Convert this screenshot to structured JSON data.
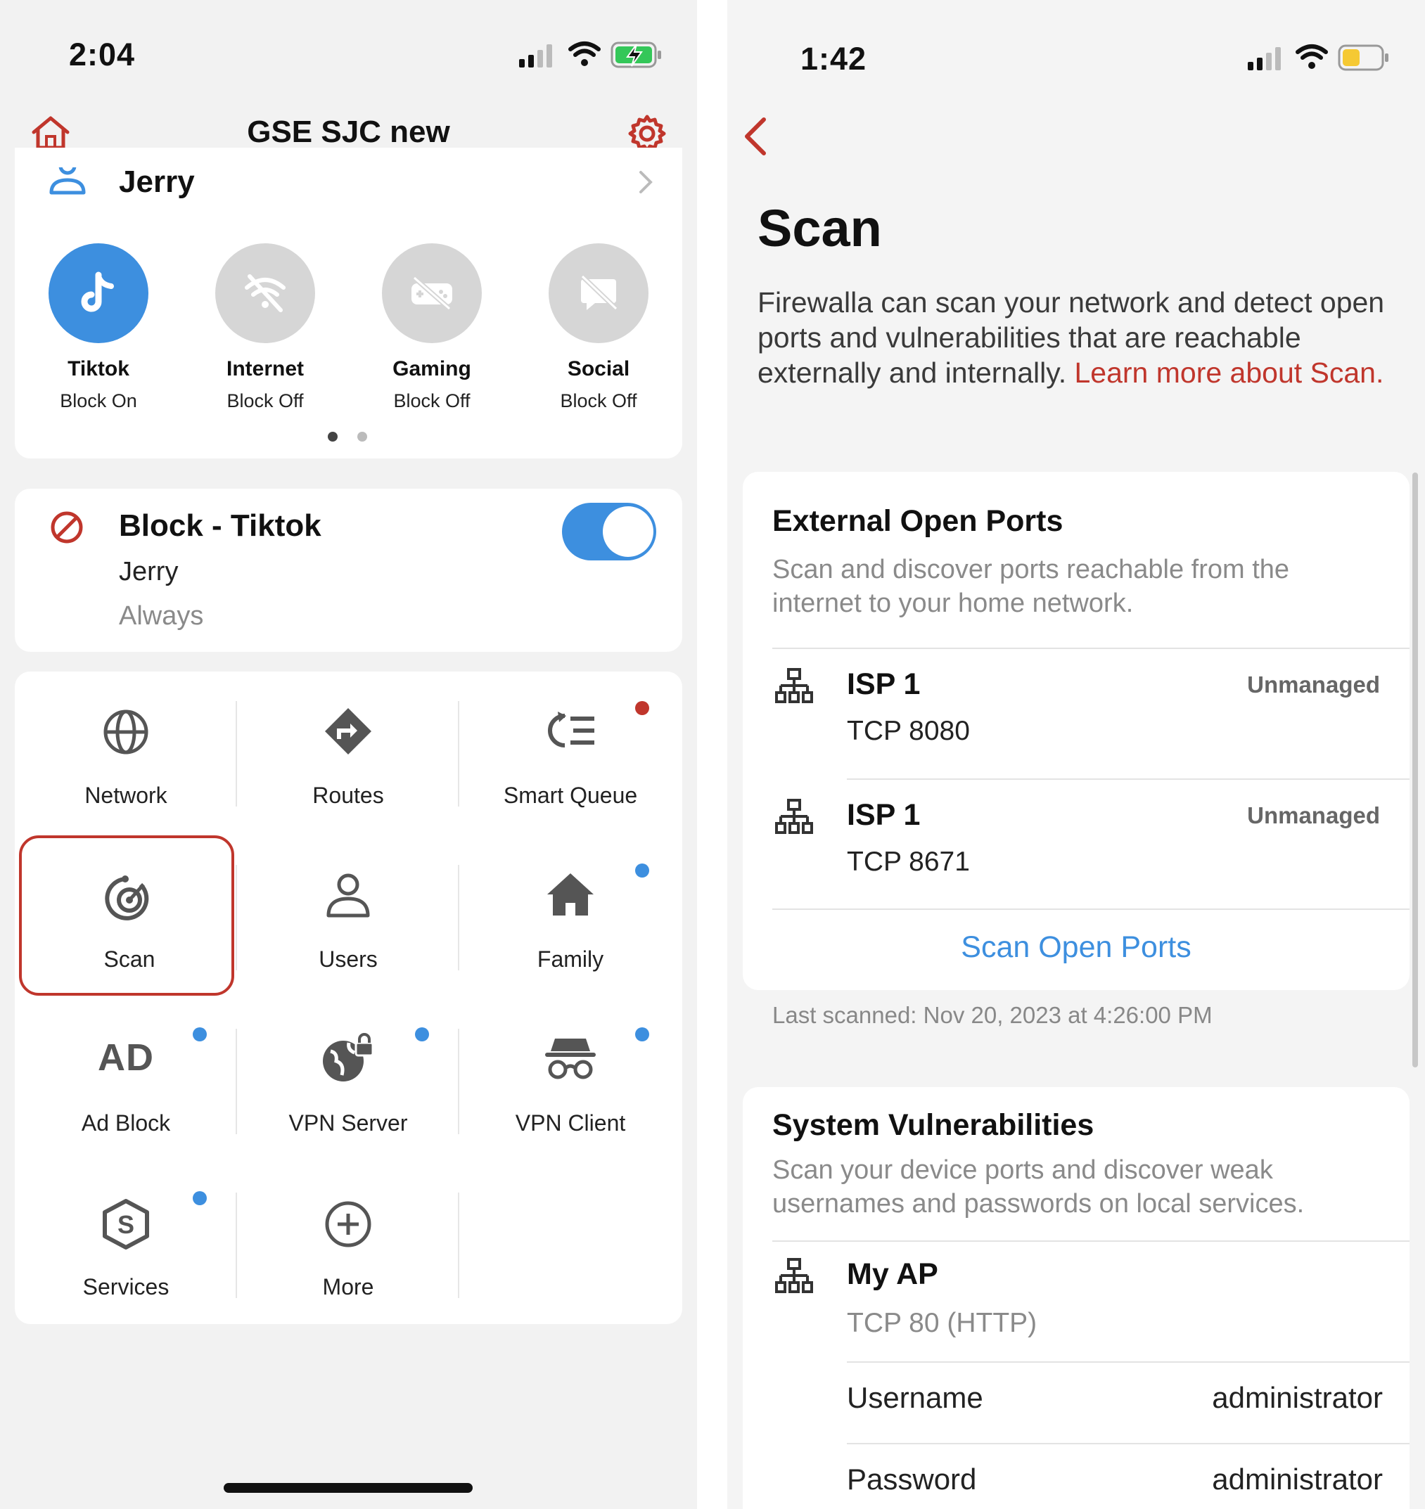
{
  "left": {
    "status_bar": {
      "time": "2:04"
    },
    "header": {
      "title": "GSE SJC new",
      "home_icon": "home-icon",
      "settings_icon": "gear-icon"
    },
    "user": {
      "name": "Jerry"
    },
    "apps": [
      {
        "name": "Tiktok",
        "status": "Block On",
        "icon": "tiktok-icon",
        "active": true
      },
      {
        "name": "Internet",
        "status": "Block Off",
        "icon": "wifi-off-icon",
        "active": false
      },
      {
        "name": "Gaming",
        "status": "Block Off",
        "icon": "gamepad-off-icon",
        "active": false
      },
      {
        "name": "Social",
        "status": "Block Off",
        "icon": "chat-off-icon",
        "active": false
      }
    ],
    "page_dots": {
      "count": 2,
      "active_index": 0
    },
    "rule": {
      "title": "Block - Tiktok",
      "target": "Jerry",
      "schedule": "Always",
      "enabled": true
    },
    "tiles": [
      {
        "label": "Network",
        "icon": "globe-icon",
        "badge": null
      },
      {
        "label": "Routes",
        "icon": "route-icon",
        "badge": null
      },
      {
        "label": "Smart Queue",
        "icon": "smart-queue-icon",
        "badge": "red"
      },
      {
        "label": "Scan",
        "icon": "radar-icon",
        "badge": null,
        "highlighted": true
      },
      {
        "label": "Users",
        "icon": "user-icon",
        "badge": null
      },
      {
        "label": "Family",
        "icon": "house-icon",
        "badge": "blue"
      },
      {
        "label": "Ad Block",
        "icon": "ad-block-icon",
        "icon_text": "AD",
        "badge": "blue"
      },
      {
        "label": "VPN Server",
        "icon": "vpn-server-icon",
        "badge": "blue"
      },
      {
        "label": "VPN Client",
        "icon": "vpn-client-icon",
        "badge": "blue"
      },
      {
        "label": "Services",
        "icon": "services-icon",
        "badge": "blue"
      },
      {
        "label": "More",
        "icon": "plus-circle-icon",
        "badge": null
      }
    ]
  },
  "right": {
    "status_bar": {
      "time": "1:42"
    },
    "back_icon": "chevron-left-icon",
    "title": "Scan",
    "description": "Firewalla can scan your network and detect open ports and vulnerabilities that are reachable externally and internally. ",
    "learn_more": "Learn more about Scan.",
    "external": {
      "title": "External Open Ports",
      "description": "Scan and discover ports reachable from the internet to your home network.",
      "items": [
        {
          "name": "ISP 1",
          "port": "TCP 8080",
          "status": "Unmanaged",
          "icon": "network-icon"
        },
        {
          "name": "ISP 1",
          "port": "TCP 8671",
          "status": "Unmanaged",
          "icon": "network-icon"
        }
      ],
      "action": "Scan Open Ports",
      "last_scanned": "Last scanned: Nov 20, 2023 at 4:26:00 PM"
    },
    "vulnerabilities": {
      "title": "System Vulnerabilities",
      "description": "Scan your device ports and discover weak usernames and passwords on local services.",
      "device": {
        "name": "My AP",
        "port": "TCP 80 (HTTP)",
        "icon": "network-icon"
      },
      "rows": [
        {
          "label": "Username",
          "value": "administrator"
        },
        {
          "label": "Password",
          "value": "administrator"
        }
      ]
    },
    "colors": {
      "accent_red": "#c0362c",
      "accent_blue": "#3d8fdf",
      "battery_yellow": "#f5c933"
    }
  }
}
